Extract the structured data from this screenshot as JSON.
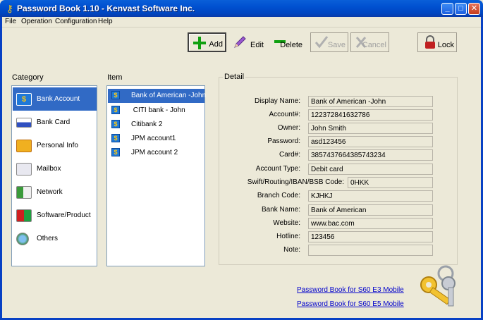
{
  "window": {
    "title": "Password Book 1.10 - Kenvast Software Inc.",
    "controls": {
      "minimize": "_",
      "maximize": "□",
      "close": "✕"
    }
  },
  "menu": [
    "File",
    "Operation",
    "Configuration",
    "Help"
  ],
  "toolbar": {
    "add": "Add",
    "edit": "Edit",
    "delete": "Delete",
    "save": "Save",
    "cancel": "Cancel",
    "lock": "Lock"
  },
  "category": {
    "heading": "Category",
    "items": [
      {
        "label": "Bank Account",
        "icon": "bank-account-icon",
        "selected": true
      },
      {
        "label": "Bank Card",
        "icon": "bank-card-icon",
        "selected": false
      },
      {
        "label": "Personal Info",
        "icon": "envelope-icon",
        "selected": false
      },
      {
        "label": "Mailbox",
        "icon": "cards-icon",
        "selected": false
      },
      {
        "label": "Network",
        "icon": "network-icon",
        "selected": false
      },
      {
        "label": "Software/Product",
        "icon": "software-icon",
        "selected": false
      },
      {
        "label": "Others",
        "icon": "globe-icon",
        "selected": false
      }
    ]
  },
  "item_list": {
    "heading": "Item",
    "items": [
      {
        "label": "Bank of American -John",
        "selected": true
      },
      {
        "label": " CITI bank - John",
        "selected": false
      },
      {
        "label": "Citibank 2",
        "selected": false
      },
      {
        "label": "JPM account1",
        "selected": false
      },
      {
        "label": "JPM account 2",
        "selected": false
      }
    ]
  },
  "detail": {
    "heading": "Detail",
    "fields": [
      {
        "label": "Display Name:",
        "value": "Bank of American -John"
      },
      {
        "label": "Account#:",
        "value": "122372841632786"
      },
      {
        "label": "Owner:",
        "value": "John Smith"
      },
      {
        "label": "Password:",
        "value": "asd123456"
      },
      {
        "label": "Card#:",
        "value": "3857437664385743234"
      },
      {
        "label": "Account Type:",
        "value": "Debit card"
      },
      {
        "label": "Swift/Routing/IBAN/BSB Code:",
        "value": "0HKK"
      },
      {
        "label": "Branch Code:",
        "value": "KJHKJ"
      },
      {
        "label": "Bank Name:",
        "value": "Bank of American"
      },
      {
        "label": "Website:",
        "value": "www.bac.com"
      },
      {
        "label": "Hotline:",
        "value": "123456"
      },
      {
        "label": "Note:",
        "value": ""
      }
    ]
  },
  "links": {
    "e3": "Password Book for S60 E3 Mobile",
    "e5": "Password Book for S60 E5 Mobile"
  },
  "colors": {
    "selection": "#316ac5",
    "titlebar": "#0050d0",
    "link": "#0000cc"
  }
}
